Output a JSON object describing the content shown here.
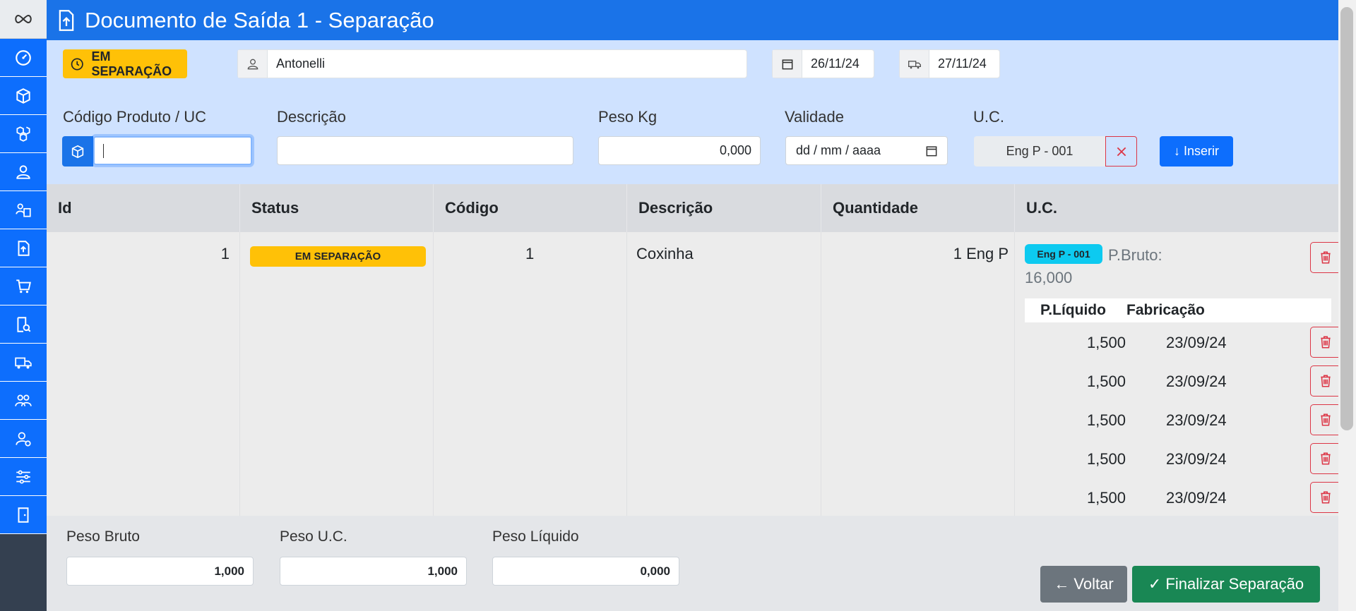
{
  "sidebar": {
    "logo_icon": "infinity-icon",
    "items": [
      {
        "icon": "dashboard-icon"
      },
      {
        "icon": "box-icon"
      },
      {
        "icon": "boxes-icon"
      },
      {
        "icon": "user-icon"
      },
      {
        "icon": "warehouse-user-icon"
      },
      {
        "icon": "file-upload-icon"
      },
      {
        "icon": "cart-icon"
      },
      {
        "icon": "document-search-icon"
      },
      {
        "icon": "truck-check-icon"
      },
      {
        "icon": "users-icon"
      },
      {
        "icon": "user-settings-icon"
      },
      {
        "icon": "sliders-icon"
      },
      {
        "icon": "exit-door-icon"
      }
    ]
  },
  "header": {
    "title": "Documento de Saída 1 - Separação"
  },
  "info": {
    "status": "EM SEPARAÇÃO",
    "client": "Antonelli",
    "date_doc": "26/11/24",
    "date_ship": "27/11/24"
  },
  "form": {
    "codigo_label": "Código Produto / UC",
    "codigo_value": "",
    "descricao_label": "Descrição",
    "descricao_value": "",
    "peso_label": "Peso Kg",
    "peso_value": "0,000",
    "validade_label": "Validade",
    "validade_placeholder": "dd / mm / aaaa",
    "uc_label": "U.C.",
    "uc_value": "Eng P - 001",
    "inserir_label": "↓ Inserir"
  },
  "table": {
    "headers": [
      "Id",
      "Status",
      "Código",
      "Descrição",
      "Quantidade",
      "U.C."
    ],
    "row": {
      "id": "1",
      "status": "EM SEPARAÇÃO",
      "codigo": "1",
      "descricao": "Coxinha",
      "quantidade": "1 Eng P",
      "uc_tag": "Eng P - 001",
      "pbruto_label": "P.Bruto:",
      "pbruto_value": "16,000",
      "sub_headers": [
        "P.Líquido",
        "Fabricação"
      ],
      "sub_rows": [
        {
          "pl": "1,500",
          "fab": "23/09/24"
        },
        {
          "pl": "1,500",
          "fab": "23/09/24"
        },
        {
          "pl": "1,500",
          "fab": "23/09/24"
        },
        {
          "pl": "1,500",
          "fab": "23/09/24"
        },
        {
          "pl": "1,500",
          "fab": "23/09/24"
        }
      ]
    }
  },
  "footer": {
    "peso_bruto_label": "Peso Bruto",
    "peso_bruto_value": "1,000",
    "peso_uc_label": "Peso U.C.",
    "peso_uc_value": "1,000",
    "peso_liquido_label": "Peso Líquido",
    "peso_liquido_value": "0,000",
    "voltar_label": "← Voltar",
    "finalizar_label": "✓ Finalizar Separação"
  },
  "colors": {
    "primary": "#1a73e8",
    "warning": "#ffc107",
    "info": "#0dcaf0",
    "success": "#198754",
    "secondary": "#6c757d",
    "danger": "#dc3545"
  }
}
